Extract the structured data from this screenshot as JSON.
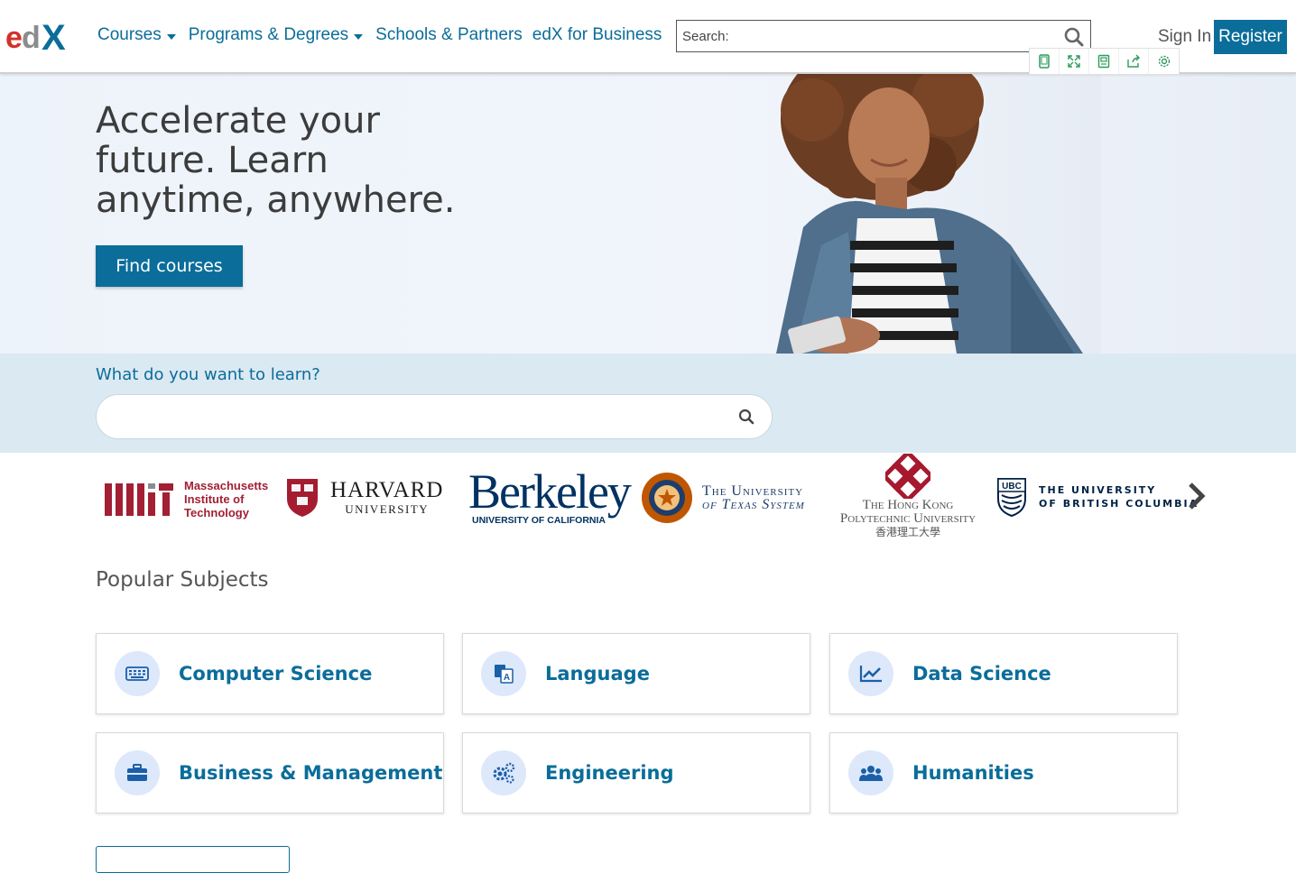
{
  "header": {
    "logo_text": "edX",
    "nav": [
      {
        "label": "Courses",
        "dropdown": true
      },
      {
        "label": "Programs & Degrees",
        "dropdown": true
      },
      {
        "label": "Schools & Partners",
        "dropdown": false
      },
      {
        "label": "edX for Business",
        "dropdown": false
      }
    ],
    "search_placeholder": "Search:",
    "sign_in": "Sign In",
    "register": "Register"
  },
  "hero": {
    "title": "Accelerate your future. Learn anytime, anywhere.",
    "button": "Find courses"
  },
  "search_band": {
    "label": "What do you want to learn?",
    "placeholder": ""
  },
  "partners": [
    {
      "name": "Massachusetts Institute of Technology",
      "line1": "Massachusetts",
      "line2": "Institute of",
      "line3": "Technology"
    },
    {
      "name": "Harvard University",
      "line1": "HARVARD",
      "line2": "UNIVERSITY"
    },
    {
      "name": "Berkeley",
      "line1": "Berkeley",
      "line2": "UNIVERSITY OF CALIFORNIA"
    },
    {
      "name": "The University of Texas System",
      "line1": "The University",
      "line2": "of Texas System"
    },
    {
      "name": "The Hong Kong Polytechnic University",
      "line1": "The Hong Kong",
      "line2": "Polytechnic University",
      "line3": "香港理工大學"
    },
    {
      "name": "The University of British Columbia",
      "line1": "THE UNIVERSITY",
      "line2": "OF BRITISH COLUMBIA",
      "badge": "UBC"
    }
  ],
  "popular": {
    "title": "Popular Subjects",
    "subjects": [
      {
        "label": "Computer Science",
        "icon": "keyboard-icon"
      },
      {
        "label": "Language",
        "icon": "translate-icon"
      },
      {
        "label": "Data Science",
        "icon": "line-chart-icon"
      },
      {
        "label": "Business & Management",
        "icon": "briefcase-icon"
      },
      {
        "label": "Engineering",
        "icon": "gears-icon"
      },
      {
        "label": "Humanities",
        "icon": "users-icon"
      }
    ]
  },
  "colors": {
    "brand_blue": "#0a6d9a",
    "logo_red": "#d23228",
    "mit_red": "#a31f34",
    "harvard_crimson": "#a51c30",
    "berkeley_navy": "#003262",
    "polyu_red": "#a6192e"
  }
}
